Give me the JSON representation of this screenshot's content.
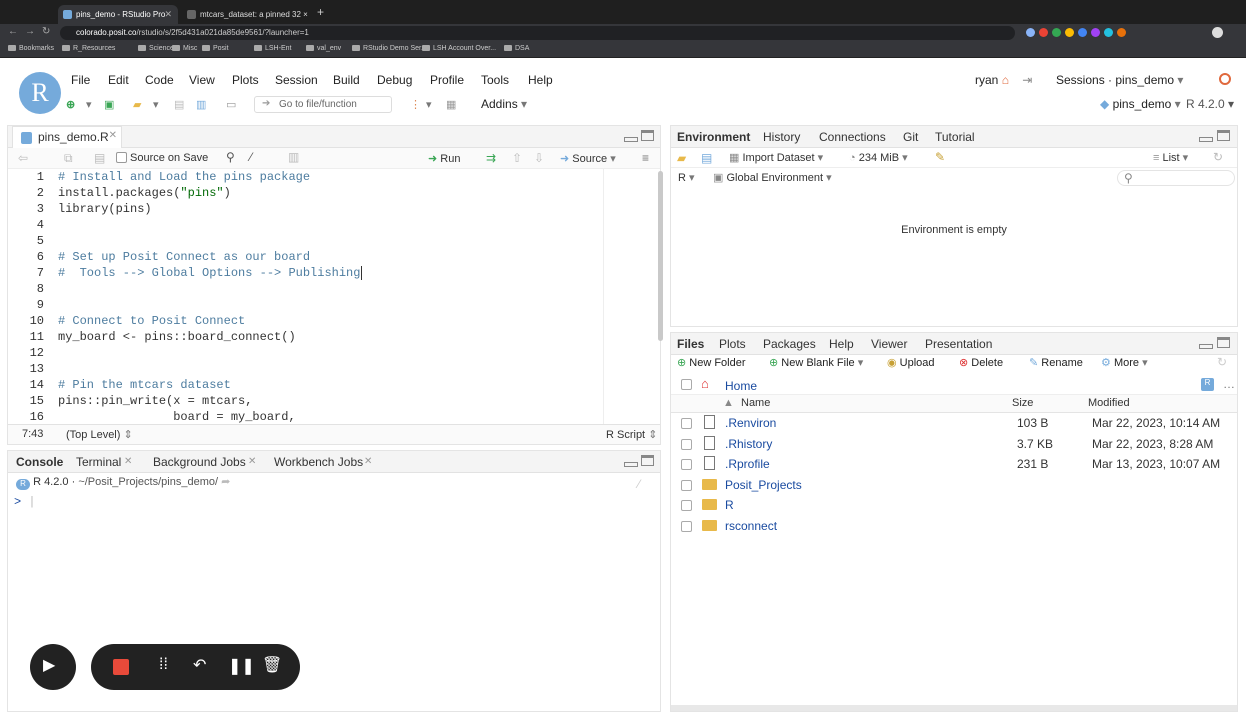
{
  "browser": {
    "tabs": [
      {
        "label": "pins_demo - RStudio Pro",
        "active": true
      },
      {
        "label": "mtcars_dataset: a pinned 32 ×",
        "active": false
      }
    ],
    "new_tab": "+",
    "url_host": "colorado.posit.co",
    "url_path": "/rstudio/s/2f5d431a021da85de9561/?launcher=1",
    "bookmarks": [
      "Bookmarks",
      "R_Resources",
      "Science",
      "Misc",
      "Posit",
      "LSH-Ent",
      "val_env",
      "RStudio Demo Ser...",
      "LSH Account Over...",
      "DSA"
    ],
    "ext_colors": [
      "#8ab4f8",
      "#ea4335",
      "#34a853",
      "#fbbc04",
      "#4285f4",
      "#a142f4",
      "#24c1e0",
      "#e8710a"
    ]
  },
  "rstudio": {
    "logo": "R",
    "menu": [
      "File",
      "Edit",
      "Code",
      "View",
      "Plots",
      "Session",
      "Build",
      "Debug",
      "Profile",
      "Tools",
      "Help"
    ],
    "goto_placeholder": "Go to file/function",
    "addins": "Addins",
    "user": "ryan",
    "sessions": "Sessions · pins_demo",
    "project": "pins_demo",
    "r_version": "R 4.2.0",
    "accent": "#75aadb"
  },
  "source": {
    "tab_label": "pins_demo.R",
    "source_on_save": "Source on Save",
    "run": "Run",
    "source_btn": "Source",
    "lines": [
      {
        "n": "1",
        "html": "<span class='cmt'># Install and Load the pins package</span>"
      },
      {
        "n": "2",
        "html": "install.packages(<span class='str'>\"pins\"</span>)"
      },
      {
        "n": "3",
        "html": "library(pins)"
      },
      {
        "n": "4",
        "html": ""
      },
      {
        "n": "5",
        "html": ""
      },
      {
        "n": "6",
        "html": "<span class='cmt'># Set up Posit Connect as our board</span>"
      },
      {
        "n": "7",
        "html": "<span class='cmt'>#  Tools --> Global Options --> Publishing</span>"
      },
      {
        "n": "8",
        "html": ""
      },
      {
        "n": "9",
        "html": ""
      },
      {
        "n": "10",
        "html": "<span class='cmt'># Connect to Posit Connect</span>"
      },
      {
        "n": "11",
        "html": "my_board <- pins::board_connect()"
      },
      {
        "n": "12",
        "html": ""
      },
      {
        "n": "13",
        "html": ""
      },
      {
        "n": "14",
        "html": "<span class='cmt'># Pin the mtcars dataset</span>"
      },
      {
        "n": "15",
        "html": "pins::pin_write(x = mtcars,"
      },
      {
        "n": "16",
        "html": "                board = my_board,"
      }
    ],
    "cursor_pos": "7:43",
    "scope": "(Top Level)",
    "file_type": "R Script"
  },
  "console": {
    "tabs": [
      "Console",
      "Terminal",
      "Background Jobs",
      "Workbench Jobs"
    ],
    "r_version": "R 4.2.0",
    "path": "~/Posit_Projects/pins_demo/",
    "prompt": ">"
  },
  "environment": {
    "tabs": [
      "Environment",
      "History",
      "Connections",
      "Git",
      "Tutorial"
    ],
    "import_dataset": "Import Dataset",
    "memory": "234 MiB",
    "view_mode": "List",
    "lang": "R",
    "scope": "Global Environment",
    "empty_msg": "Environment is empty"
  },
  "files": {
    "tabs": [
      "Files",
      "Plots",
      "Packages",
      "Help",
      "Viewer",
      "Presentation"
    ],
    "toolbar": [
      "New Folder",
      "New Blank File",
      "Upload",
      "Delete",
      "Rename",
      "More"
    ],
    "home": "Home",
    "columns": [
      "Name",
      "Size",
      "Modified"
    ],
    "rows": [
      {
        "name": ".Renviron",
        "size": "103 B",
        "modified": "Mar 22, 2023, 10:14 AM",
        "kind": "doc"
      },
      {
        "name": ".Rhistory",
        "size": "3.7 KB",
        "modified": "Mar 22, 2023, 8:28 AM",
        "kind": "doc"
      },
      {
        "name": ".Rprofile",
        "size": "231 B",
        "modified": "Mar 13, 2023, 10:07 AM",
        "kind": "doc"
      },
      {
        "name": "Posit_Projects",
        "size": "",
        "modified": "",
        "kind": "folder"
      },
      {
        "name": "R",
        "size": "",
        "modified": "",
        "kind": "folder"
      },
      {
        "name": "rsconnect",
        "size": "",
        "modified": "",
        "kind": "folder"
      }
    ]
  }
}
